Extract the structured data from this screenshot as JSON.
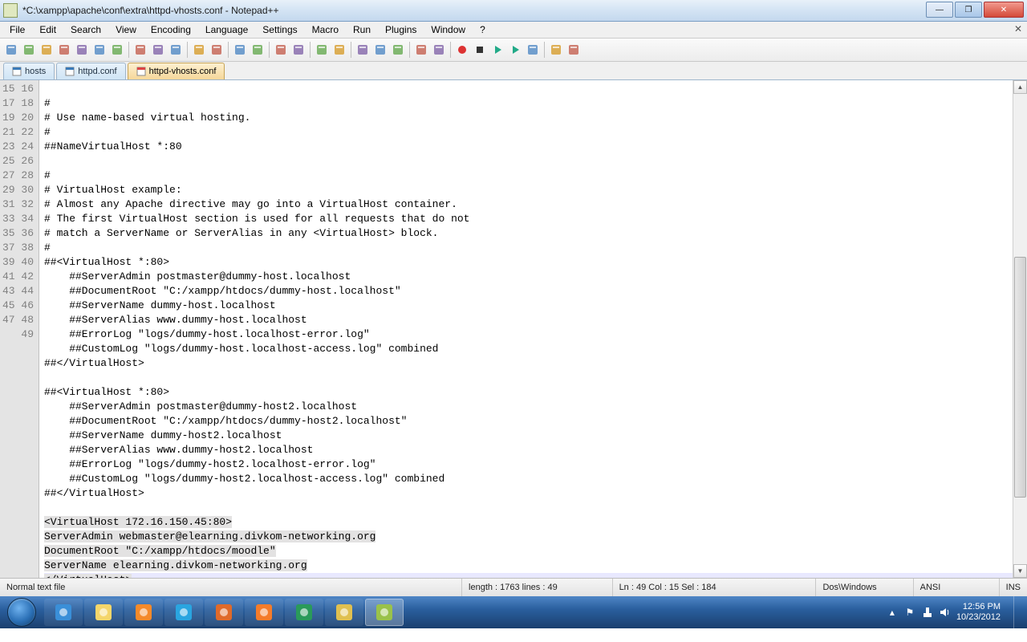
{
  "window": {
    "title": "*C:\\xampp\\apache\\conf\\extra\\httpd-vhosts.conf - Notepad++"
  },
  "menu": [
    "File",
    "Edit",
    "Search",
    "View",
    "Encoding",
    "Language",
    "Settings",
    "Macro",
    "Run",
    "Plugins",
    "Window",
    "?"
  ],
  "tabs": [
    {
      "label": "hosts",
      "active": false
    },
    {
      "label": "httpd.conf",
      "active": false
    },
    {
      "label": "httpd-vhosts.conf",
      "active": true
    }
  ],
  "editor": {
    "first_line_no": 15,
    "lines": [
      "",
      "#",
      "# Use name-based virtual hosting.",
      "#",
      "##NameVirtualHost *:80",
      "",
      "#",
      "# VirtualHost example:",
      "# Almost any Apache directive may go into a VirtualHost container.",
      "# The first VirtualHost section is used for all requests that do not",
      "# match a ServerName or ServerAlias in any <VirtualHost> block.",
      "#",
      "##<VirtualHost *:80>",
      "    ##ServerAdmin postmaster@dummy-host.localhost",
      "    ##DocumentRoot \"C:/xampp/htdocs/dummy-host.localhost\"",
      "    ##ServerName dummy-host.localhost",
      "    ##ServerAlias www.dummy-host.localhost",
      "    ##ErrorLog \"logs/dummy-host.localhost-error.log\"",
      "    ##CustomLog \"logs/dummy-host.localhost-access.log\" combined",
      "##</VirtualHost>",
      "",
      "##<VirtualHost *:80>",
      "    ##ServerAdmin postmaster@dummy-host2.localhost",
      "    ##DocumentRoot \"C:/xampp/htdocs/dummy-host2.localhost\"",
      "    ##ServerName dummy-host2.localhost",
      "    ##ServerAlias www.dummy-host2.localhost",
      "    ##ErrorLog \"logs/dummy-host2.localhost-error.log\"",
      "    ##CustomLog \"logs/dummy-host2.localhost-access.log\" combined",
      "##</VirtualHost>",
      "",
      "<VirtualHost 172.16.150.45:80>",
      "ServerAdmin webmaster@elearning.divkom-networking.org",
      "DocumentRoot \"C:/xampp/htdocs/moodle\"",
      "ServerName elearning.divkom-networking.org",
      "</VirtualHost>"
    ],
    "selection_lines": [
      45,
      46,
      47,
      48,
      49
    ],
    "cursor_line": 49
  },
  "status": {
    "filetype": "Normal text file",
    "length": "length : 1763    lines : 49",
    "pos": "Ln : 49    Col : 15    Sel : 184",
    "eol": "Dos\\Windows",
    "enc": "ANSI",
    "mode": "INS"
  },
  "tray": {
    "time": "12:56 PM",
    "date": "10/23/2012"
  },
  "toolbar_icons": [
    "new-icon",
    "open-icon",
    "save-icon",
    "save-all-icon",
    "close-icon",
    "close-all-icon",
    "print-icon",
    "sep",
    "cut-icon",
    "copy-icon",
    "paste-icon",
    "sep",
    "undo-icon",
    "redo-icon",
    "sep",
    "find-icon",
    "replace-icon",
    "sep",
    "zoom-in-icon",
    "zoom-out-icon",
    "sep",
    "sync-v-icon",
    "sync-h-icon",
    "sep",
    "wrap-icon",
    "whitespace-icon",
    "indent-guide-icon",
    "sep",
    "lang-icon",
    "doc-map-icon",
    "sep",
    "record-icon",
    "stop-icon",
    "play-icon",
    "play-multi-icon",
    "save-macro-icon",
    "sep",
    "folder-icon",
    "monitor-icon"
  ],
  "task_apps": [
    "ie-icon",
    "explorer-icon",
    "wmp-icon",
    "skype-icon",
    "firefox-icon",
    "xampp-icon",
    "idm-icon",
    "paint-icon",
    "notepadpp-icon"
  ]
}
